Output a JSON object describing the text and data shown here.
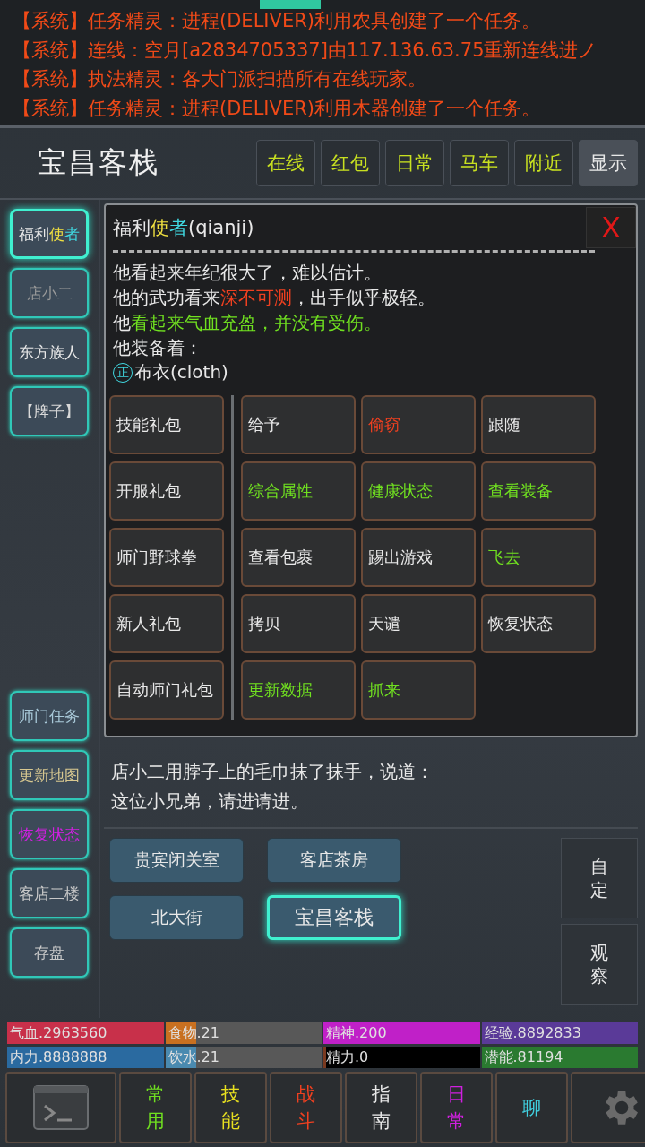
{
  "messages": [
    {
      "tag": "【系统】",
      "text": "任务精灵：进程(DELIVER)利用农具创建了一个任务。"
    },
    {
      "tag": "【系统】",
      "text": "连线：空月[a2834705337]由117.136.63.75重新连线进ノ"
    },
    {
      "tag": "【系统】",
      "text": "执法精灵：各大门派扫描所有在线玩家。"
    },
    {
      "tag": "【系统】",
      "text": "任务精灵：进程(DELIVER)利用木器创建了一个任务。"
    }
  ],
  "location": "宝昌客栈",
  "top_buttons": [
    {
      "label": "在线",
      "selected": false
    },
    {
      "label": "红包",
      "selected": false
    },
    {
      "label": "日常",
      "selected": false
    },
    {
      "label": "马车",
      "selected": false
    },
    {
      "label": "附近",
      "selected": false
    },
    {
      "label": "显示",
      "selected": true
    }
  ],
  "sidebar": [
    {
      "parts": [
        {
          "text": "福利",
          "color": "#e8e8e8"
        },
        {
          "text": "使",
          "color": "#f0e040"
        },
        {
          "text": "者",
          "color": "#40d8e0"
        }
      ],
      "selected": true
    },
    {
      "parts": [
        {
          "text": "店小二",
          "color": "#9a9a9a"
        }
      ],
      "selected": false
    },
    {
      "parts": [
        {
          "text": "东方族人",
          "color": "#e8e8e8"
        }
      ],
      "selected": false
    },
    {
      "parts": [
        {
          "text": "【牌子】",
          "color": "#d8d8d8"
        }
      ],
      "selected": false
    },
    {
      "parts": [
        {
          "text": "师门任务",
          "color": "#a8c8d8"
        }
      ],
      "selected": false
    },
    {
      "parts": [
        {
          "text": "更新地图",
          "color": "#d8c890"
        }
      ],
      "selected": false
    },
    {
      "parts": [
        {
          "text": "恢复状态",
          "color": "#d020e0"
        }
      ],
      "selected": false
    },
    {
      "parts": [
        {
          "text": "客店二楼",
          "color": "#c8c8c8"
        }
      ],
      "selected": false
    },
    {
      "parts": [
        {
          "text": "存盘",
          "color": "#c8c8c8"
        }
      ],
      "selected": false
    }
  ],
  "dialog": {
    "title": [
      {
        "text": "福利",
        "color": "#e8e8e8"
      },
      {
        "text": "使",
        "color": "#f0e040"
      },
      {
        "text": "者",
        "color": "#40d8e0"
      },
      {
        "text": "(qianji)",
        "color": "#e8e8e8"
      }
    ],
    "close": "X",
    "lines": [
      [
        {
          "text": "他看起来年纪很大了，难以估计。",
          "color": "#e8e8e8"
        }
      ],
      [
        {
          "text": "他的武功看来",
          "color": "#e8e8e8"
        },
        {
          "text": "深不可测",
          "color": "#f04020"
        },
        {
          "text": "，出手似乎极轻。",
          "color": "#e8e8e8"
        }
      ],
      [
        {
          "text": "他",
          "color": "#e8e8e8"
        },
        {
          "text": "看起来气血充盈，并没有受伤。",
          "color": "#70e020"
        }
      ],
      [
        {
          "text": "他装备着：",
          "color": "#e8e8e8"
        }
      ]
    ],
    "equipment": [
      {
        "badge": "正",
        "name": "布衣(cloth)"
      }
    ],
    "gift_buttons": [
      {
        "label": "技能礼包"
      },
      {
        "label": "开服礼包"
      },
      {
        "label": "师门野球拳"
      },
      {
        "label": "新人礼包"
      },
      {
        "label": "自动师门礼包"
      }
    ],
    "actions": [
      {
        "label": "给予",
        "color": "#e8e8e8"
      },
      {
        "label": "偷窃",
        "color": "#f04020"
      },
      {
        "label": "跟随",
        "color": "#e8e8e8"
      },
      {
        "label": "综合属性",
        "color": "#70e020"
      },
      {
        "label": "健康状态",
        "color": "#70e020"
      },
      {
        "label": "查看装备",
        "color": "#70e020"
      },
      {
        "label": "查看包裹",
        "color": "#e8e8e8"
      },
      {
        "label": "踢出游戏",
        "color": "#e8e8e8"
      },
      {
        "label": "飞去",
        "color": "#70e020"
      },
      {
        "label": "拷贝",
        "color": "#e8e8e8"
      },
      {
        "label": "天谴",
        "color": "#e8e8e8"
      },
      {
        "label": "恢复状态",
        "color": "#e8e8e8"
      },
      {
        "label": "更新数据",
        "color": "#70e020"
      },
      {
        "label": "抓来",
        "color": "#70e020"
      }
    ]
  },
  "room_text": [
    "店小二用脖子上的毛巾抹了抹手，说道：",
    "这位小兄弟，请进请进。"
  ],
  "exits": [
    {
      "label": "贵宾闭关室",
      "selected": false
    },
    {
      "label": "客店茶房",
      "selected": false
    },
    {
      "label": "北大街",
      "selected": false
    },
    {
      "label": "宝昌客栈",
      "selected": true
    }
  ],
  "side_actions": [
    "自定",
    "观察"
  ],
  "stats": [
    {
      "label": "气血.2963560",
      "level": 1,
      "color": "#c8304a"
    },
    {
      "label": "食物.21",
      "level": 0.2,
      "color": "#c87020"
    },
    {
      "label": "精神.200",
      "level": 1,
      "color": "#c020c8"
    },
    {
      "label": "经验.8892833",
      "level": 1,
      "color": "#5a3a98"
    },
    {
      "label": "内力.8888888",
      "level": 1,
      "color": "#2a6aa0"
    },
    {
      "label": "饮水.21",
      "level": 0.2,
      "color": "#4a8ab0"
    },
    {
      "label": "精力.0",
      "level": 0,
      "color": "#7a3a20"
    },
    {
      "label": "潜能.81194",
      "level": 1,
      "color": "#2a7a30"
    }
  ],
  "nav": [
    {
      "kind": "terminal"
    },
    {
      "kind": "text",
      "label": "常用",
      "color": "#70e020"
    },
    {
      "kind": "text",
      "label": "技能",
      "color": "#e8e020"
    },
    {
      "kind": "text",
      "label": "战斗",
      "color": "#f04020"
    },
    {
      "kind": "text",
      "label": "指南",
      "color": "#e8e8e8"
    },
    {
      "kind": "text",
      "label": "日常",
      "color": "#d020e0"
    },
    {
      "kind": "text",
      "label": "聊",
      "color": "#40d0e0"
    },
    {
      "kind": "settings"
    }
  ]
}
